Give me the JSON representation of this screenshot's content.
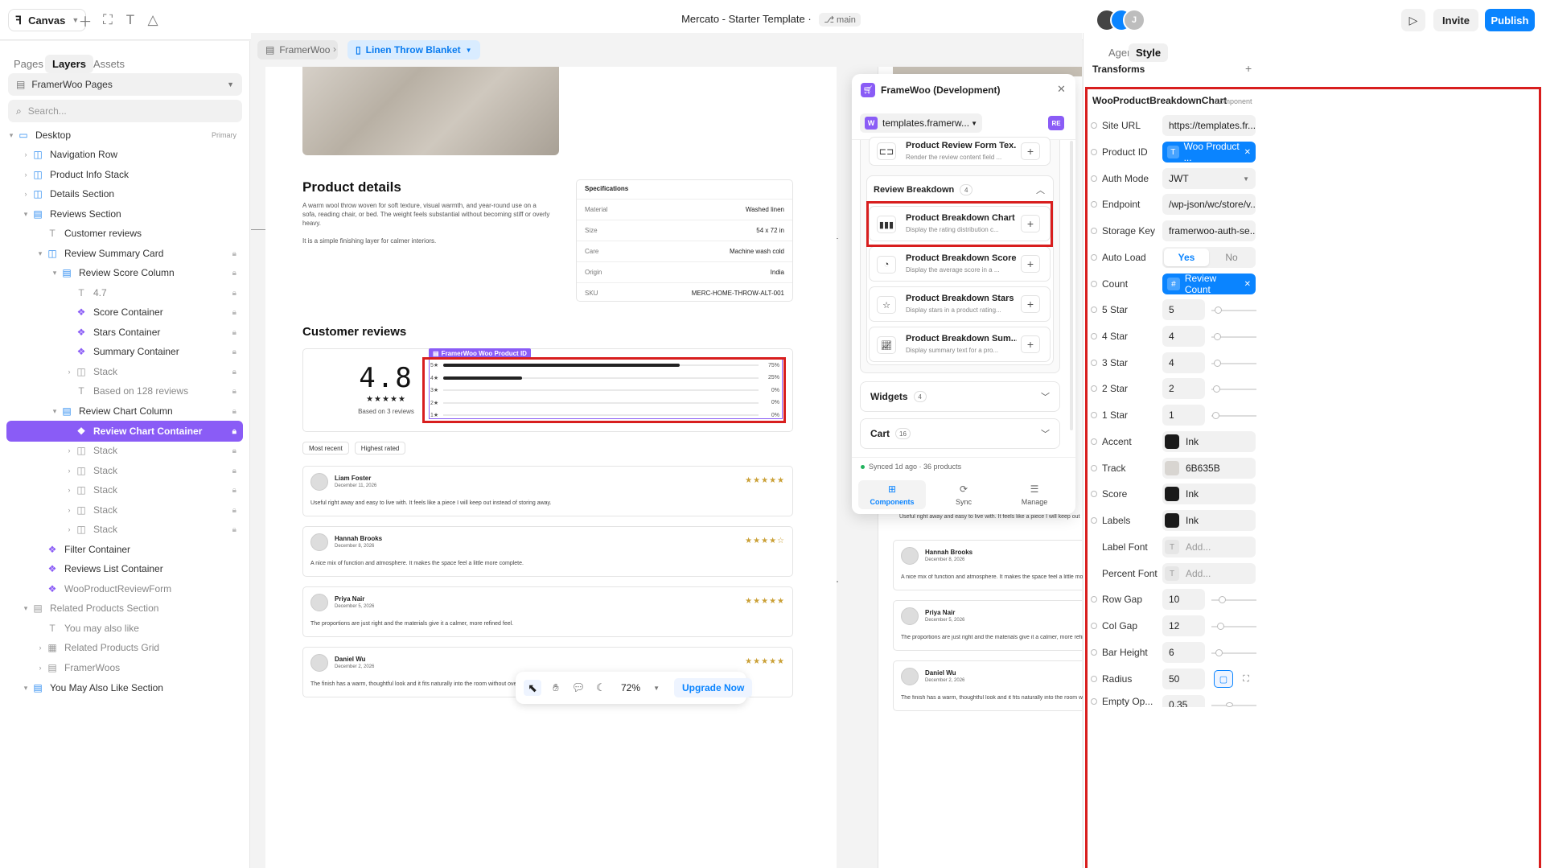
{
  "topbar": {
    "project_menu": "Canvas",
    "title": "Mercato - Starter Template",
    "branch": "main",
    "avatar_initial": "J",
    "invite_label": "Invite",
    "publish_label": "Publish"
  },
  "left_panel": {
    "tabs": [
      "Pages",
      "Layers",
      "Assets"
    ],
    "pages_select": "FramerWoo Pages",
    "search_placeholder": "Search...",
    "layers": [
      {
        "label": "Desktop",
        "badge": "Primary"
      },
      {
        "label": "Navigation Row"
      },
      {
        "label": "Product Info Stack"
      },
      {
        "label": "Details Section"
      },
      {
        "label": "Reviews Section"
      },
      {
        "label": "Customer reviews"
      },
      {
        "label": "Review Summary Card"
      },
      {
        "label": "Review Score Column"
      },
      {
        "label": "4.7"
      },
      {
        "label": "Score Container"
      },
      {
        "label": "Stars Container"
      },
      {
        "label": "Summary Container"
      },
      {
        "label": "Stack"
      },
      {
        "label": "Based on 128 reviews"
      },
      {
        "label": "Review Chart Column"
      },
      {
        "label": "Review Chart Container"
      },
      {
        "label": "Stack"
      },
      {
        "label": "Stack"
      },
      {
        "label": "Stack"
      },
      {
        "label": "Stack"
      },
      {
        "label": "Stack"
      },
      {
        "label": "Filter Container"
      },
      {
        "label": "Reviews List Container"
      },
      {
        "label": "WooProductReviewForm"
      },
      {
        "label": "Related Products Section"
      },
      {
        "label": "You may also like"
      },
      {
        "label": "Related Products Grid"
      },
      {
        "label": "FramerWoos"
      },
      {
        "label": "You May Also Like Section"
      }
    ]
  },
  "breadcrumb": {
    "root": "FramerWoo",
    "current": "Linen Throw Blanket"
  },
  "page": {
    "details_heading": "Product details",
    "details_text_1": "A warm wool throw woven for soft texture, visual warmth, and year-round use on a sofa, reading chair, or bed. The weight feels substantial without becoming stiff or overly heavy.",
    "details_text_2": "It is a simple finishing layer for calmer interiors.",
    "specs_title": "Specifications",
    "specs": [
      {
        "key": "Material",
        "value": "Washed linen"
      },
      {
        "key": "Size",
        "value": "54 x 72 in"
      },
      {
        "key": "Care",
        "value": "Machine wash cold"
      },
      {
        "key": "Origin",
        "value": "India"
      },
      {
        "key": "SKU",
        "value": "MERC-HOME-THROW-ALT-001"
      }
    ],
    "reviews_heading": "Customer reviews",
    "score": "4.8",
    "stars": "★★★★★",
    "based_on": "Based on 3 reviews",
    "tag": "FramerWoo Woo Product ID",
    "breakdown": [
      {
        "label": "5★",
        "pct": "75%",
        "value": 0.75
      },
      {
        "label": "4★",
        "pct": "25%",
        "value": 0.25
      },
      {
        "label": "3★",
        "pct": "0%",
        "value": 0
      },
      {
        "label": "2★",
        "pct": "0%",
        "value": 0
      },
      {
        "label": "1★",
        "pct": "0%",
        "value": 0
      }
    ],
    "filters": [
      "Most recent",
      "Highest rated"
    ],
    "reviews": [
      {
        "name": "Liam Foster",
        "date": "December 11, 2026",
        "stars": "★★★★★",
        "text": "Useful right away and easy to live with. It feels like a piece I will keep out instead of storing away."
      },
      {
        "name": "Hannah Brooks",
        "date": "December 8, 2026",
        "stars": "★★★★☆",
        "text": "A nice mix of function and atmosphere. It makes the space feel a little more complete."
      },
      {
        "name": "Priya Nair",
        "date": "December 5, 2026",
        "stars": "★★★★★",
        "text": "The proportions are just right and the materials give it a calmer, more refined feel."
      },
      {
        "name": "Daniel Wu",
        "date": "December 2, 2026",
        "stars": "★★★★★",
        "text": "The finish has a warm, thoughtful look and it fits naturally into the room without overwhelming it."
      }
    ]
  },
  "plugin": {
    "title": "FrameWoo (Development)",
    "site": "templates.framerw...",
    "site_badge": "RE",
    "top_item": {
      "title": "Product Review Form Tex...",
      "desc": "Render the review content field ..."
    },
    "section_title": "Review Breakdown",
    "section_count": "4",
    "items": [
      {
        "title": "Product Breakdown Chart",
        "desc": "Display the rating distribution c...",
        "icon": "bar-chart-icon"
      },
      {
        "title": "Product Breakdown Score",
        "desc": "Display the average score in a ...",
        "icon": "gauge-icon"
      },
      {
        "title": "Product Breakdown Stars",
        "desc": "Display stars in a product rating...",
        "icon": "star-icon"
      },
      {
        "title": "Product Breakdown Sum...",
        "desc": "Display summary text for a pro...",
        "icon": "trend-chart-icon"
      }
    ],
    "widgets_label": "Widgets",
    "widgets_count": "4",
    "cart_label": "Cart",
    "cart_count": "16",
    "sync_status": "Synced 1d ago · 36 products",
    "nav": [
      "Components",
      "Sync",
      "Manage"
    ]
  },
  "bottom_toolbar": {
    "zoom": "72%",
    "upgrade": "Upgrade Now"
  },
  "right_panel": {
    "tabs": [
      "Agent",
      "Style"
    ],
    "section": "Transforms",
    "component_name": "WooProductBreakdownChart",
    "component_badge": "Component",
    "site_url": {
      "label": "Site URL",
      "value": "https://templates.fr..."
    },
    "product_id": {
      "label": "Product ID",
      "value": "Woo Product ..."
    },
    "auth_mode": {
      "label": "Auth Mode",
      "value": "JWT"
    },
    "endpoint": {
      "label": "Endpoint",
      "value": "/wp-json/wc/store/v..."
    },
    "storage_key": {
      "label": "Storage Key",
      "value": "framerwoo-auth-se..."
    },
    "auto_load": {
      "label": "Auto Load",
      "yes": "Yes",
      "no": "No"
    },
    "count": {
      "label": "Count",
      "value": "Review Count"
    },
    "star_rows": [
      {
        "label": "5 Star",
        "value": "5"
      },
      {
        "label": "4 Star",
        "value": "4"
      },
      {
        "label": "3 Star",
        "value": "4"
      },
      {
        "label": "2 Star",
        "value": "2"
      },
      {
        "label": "1 Star",
        "value": "1"
      }
    ],
    "colors": [
      {
        "label": "Accent",
        "value": "Ink",
        "color": "#1a1a1a"
      },
      {
        "label": "Track",
        "value": "6B635B",
        "color": "#d8d5d1"
      },
      {
        "label": "Score",
        "value": "Ink",
        "color": "#1a1a1a"
      },
      {
        "label": "Labels",
        "value": "Ink",
        "color": "#1a1a1a"
      }
    ],
    "label_font": {
      "label": "Label Font",
      "placeholder": "Add..."
    },
    "percent_font": {
      "label": "Percent Font",
      "placeholder": "Add..."
    },
    "spacing": [
      {
        "label": "Row Gap",
        "value": "10"
      },
      {
        "label": "Col Gap",
        "value": "12"
      },
      {
        "label": "Bar Height",
        "value": "6"
      },
      {
        "label": "Radius",
        "value": "50"
      },
      {
        "label": "Empty Op...",
        "value": "0.35"
      }
    ]
  },
  "colors": {
    "accent_blue": "#0a84ff",
    "selection_purple": "#8a5cf6",
    "highlight_red": "#d81e1e"
  }
}
